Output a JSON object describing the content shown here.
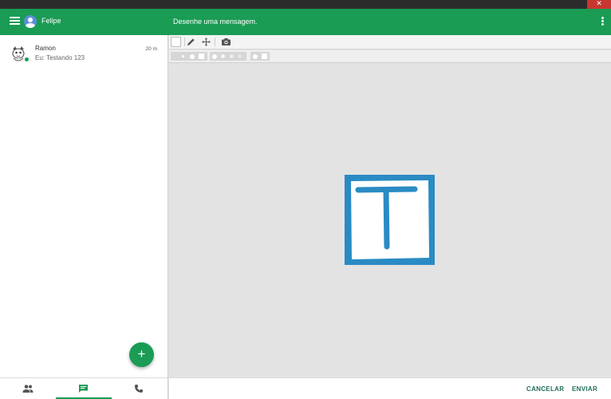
{
  "window": {
    "close_glyph": "✕"
  },
  "header": {
    "menu_icon": "hamburger-icon",
    "user_name": "Felipe",
    "draw_title": "Desenhe uma mensagem.",
    "more_icon": "more-vert-icon"
  },
  "conversations": [
    {
      "name": "Ramon",
      "preview": "Eu: Testando 123",
      "time": "20 m",
      "online": true
    }
  ],
  "fab": {
    "label": "+"
  },
  "bottom_nav": {
    "tabs": [
      {
        "icon": "people-icon"
      },
      {
        "icon": "chat-icon",
        "active": true
      },
      {
        "icon": "phone-icon"
      }
    ]
  },
  "toolbar": {
    "tools": [
      "color-swatch",
      "pencil-icon",
      "move-icon",
      "camera-icon"
    ]
  },
  "drawing": {
    "letter": "T",
    "stroke_color": "#2a8bc4"
  },
  "footer": {
    "cancel_label": "CANCELAR",
    "send_label": "ENVIAR"
  },
  "colors": {
    "primary": "#1a9c55",
    "accent_text": "#1f6f5b"
  }
}
